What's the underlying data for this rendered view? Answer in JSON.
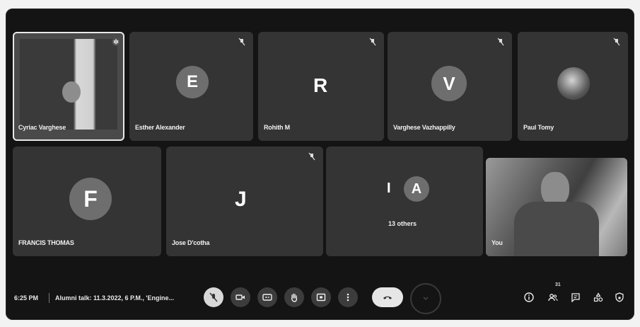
{
  "participants": [
    {
      "name": "Cyriac Varghese",
      "avatar": "",
      "video": true
    },
    {
      "name": "Esther Alexander",
      "avatar": "E"
    },
    {
      "name": "Rohith M",
      "avatar": "R"
    },
    {
      "name": "Varghese Vazhappilly",
      "avatar": "V"
    },
    {
      "name": "Paul Tomy",
      "avatar": "",
      "photo": true
    },
    {
      "name": "FRANCIS THOMAS",
      "avatar": "F"
    },
    {
      "name": "Jose D'cotha",
      "avatar": "J"
    },
    {
      "name": "You",
      "avatar": "",
      "video": true
    }
  ],
  "others": {
    "letters": [
      "I",
      "A"
    ],
    "label": "13 others"
  },
  "bottom_bar": {
    "time": "6:25 PM",
    "meeting_title": "Alumni talk: 11.3.2022, 6 P.M., 'Engine...",
    "people_count": "31"
  },
  "colors": {
    "background": "#141414",
    "tile": "#343434",
    "avatar": "#6e6e6e",
    "end_call": "#e6e6e6"
  }
}
